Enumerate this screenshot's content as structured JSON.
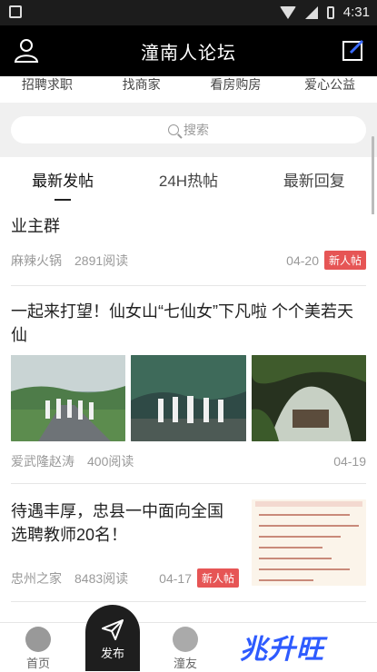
{
  "status": {
    "time": "4:31"
  },
  "appbar": {
    "title": "潼南人论坛"
  },
  "categories": [
    "招聘求职",
    "找商家",
    "看房购房",
    "爱心公益"
  ],
  "search": {
    "placeholder": "搜索"
  },
  "tabs": [
    "最新发帖",
    "24H热帖",
    "最新回复"
  ],
  "posts": [
    {
      "title": "业主群",
      "author": "麻辣火锅",
      "reads": "2891阅读",
      "date": "04-20",
      "badge": "新人帖"
    },
    {
      "title": "一起来打望！仙女山“七仙女”下凡啦 个个美若天仙",
      "author": "爱武隆赵涛",
      "reads": "400阅读",
      "date": "04-19"
    },
    {
      "title": "待遇丰厚，忠县一中面向全国选聘教师20名！",
      "author": "忠州之家",
      "reads": "8483阅读",
      "date": "04-17",
      "badge": "新人帖"
    }
  ],
  "bottom_nav": {
    "home": "首页",
    "publish": "发布",
    "third": "潼友"
  },
  "logo_text": "兆升旺",
  "colors": {
    "badge": "#e65555",
    "appbar": "#000000",
    "logo": "#2e5bff"
  }
}
